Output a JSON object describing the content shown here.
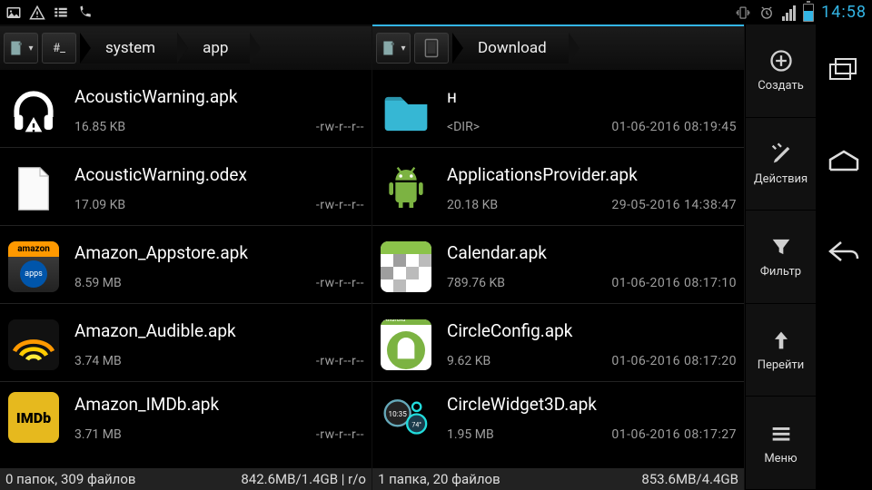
{
  "statusbar": {
    "time": "14:58"
  },
  "panes": [
    {
      "active": false,
      "breadcrumbs": [
        "system",
        "app"
      ],
      "footer_left": "0 папок, 309 файлов",
      "footer_right": "842.6MB/1.4GB | r/o",
      "files": [
        {
          "name": "AcousticWarning.apk",
          "sub1": "16.85 KB",
          "sub2": "-rw-r--r--",
          "icon": "headphones"
        },
        {
          "name": "AcousticWarning.odex",
          "sub1": "17.09 KB",
          "sub2": "-rw-r--r--",
          "icon": "sheet"
        },
        {
          "name": "Amazon_Appstore.apk",
          "sub1": "8.59 MB",
          "sub2": "-rw-r--r--",
          "icon": "amazon-apps"
        },
        {
          "name": "Amazon_Audible.apk",
          "sub1": "3.74 MB",
          "sub2": "-rw-r--r--",
          "icon": "audible"
        },
        {
          "name": "Amazon_IMDb.apk",
          "sub1": "3.71 MB",
          "sub2": "-rw-r--r--",
          "icon": "imdb"
        }
      ]
    },
    {
      "active": true,
      "breadcrumbs": [
        "Download"
      ],
      "footer_left": "1 папка, 20 файлов",
      "footer_right": "853.6MB/4.4GB",
      "files": [
        {
          "name": "н",
          "sub1": "<DIR>",
          "sub2": "01-06-2016 08:19:45",
          "icon": "folder"
        },
        {
          "name": "ApplicationsProvider.apk",
          "sub1": "20.18 KB",
          "sub2": "29-05-2016 14:38:47",
          "icon": "android-box"
        },
        {
          "name": "Calendar.apk",
          "sub1": "789.76 KB",
          "sub2": "01-06-2016 08:17:10",
          "icon": "calendar"
        },
        {
          "name": "CircleConfig.apk",
          "sub1": "9.62 KB",
          "sub2": "01-06-2016 08:17:20",
          "icon": "circle-config"
        },
        {
          "name": "CircleWidget3D.apk",
          "sub1": "1.95 MB",
          "sub2": "01-06-2016 08:17:27",
          "icon": "circle-widget"
        }
      ]
    }
  ],
  "toolbar": {
    "create": "Создать",
    "actions": "Действия",
    "filter": "Фильтр",
    "goto": "Перейти",
    "menu": "Меню"
  }
}
